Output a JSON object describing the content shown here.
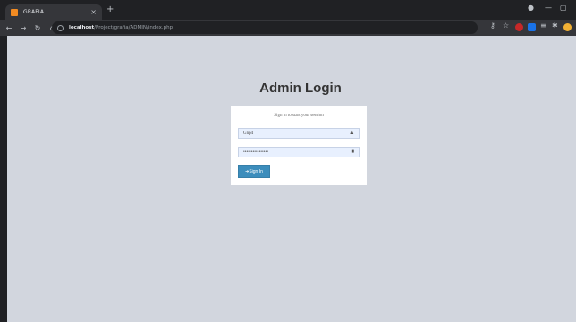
{
  "browser": {
    "tab_title": "GRAFIA",
    "tab_close": "×",
    "new_tab": "+",
    "url_host": "localhost",
    "url_path": "/Project/grafia/ADMIN/index.php",
    "icons": [
      "back-icon",
      "forward-icon",
      "reload-icon",
      "home-icon",
      "key-icon",
      "star-icon",
      "extension-icons",
      "puzzle-icon",
      "avatar-icon"
    ]
  },
  "page": {
    "heading": "Admin Login",
    "message": "Sign in to start your session",
    "username_value": "Gnp4",
    "password_value": "••••••••••••••••",
    "signin_label": "Sign In",
    "colors": {
      "background": "#d2d6de",
      "button": "#3c8dbc"
    }
  }
}
